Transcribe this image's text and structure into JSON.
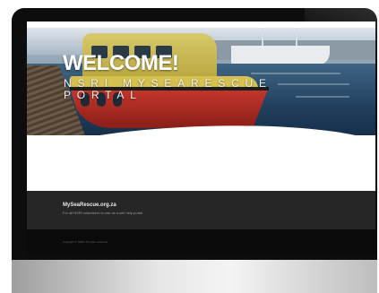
{
  "hero": {
    "heading": "WELCOME!",
    "subheading": "NSRI MYSEARESCUE PORTAL"
  },
  "footer": {
    "site_name": "MySeaRescue.org.za",
    "tagline": "For all NSRI volunteers to use as a self help portal",
    "copyright": "Copyright © NSRI. All rights reserved."
  },
  "colors": {
    "bezel": "#0d0d0d",
    "footer_bg": "#262626",
    "hull_red": "#c8382c",
    "cabin_yellow": "#d8c96a"
  }
}
